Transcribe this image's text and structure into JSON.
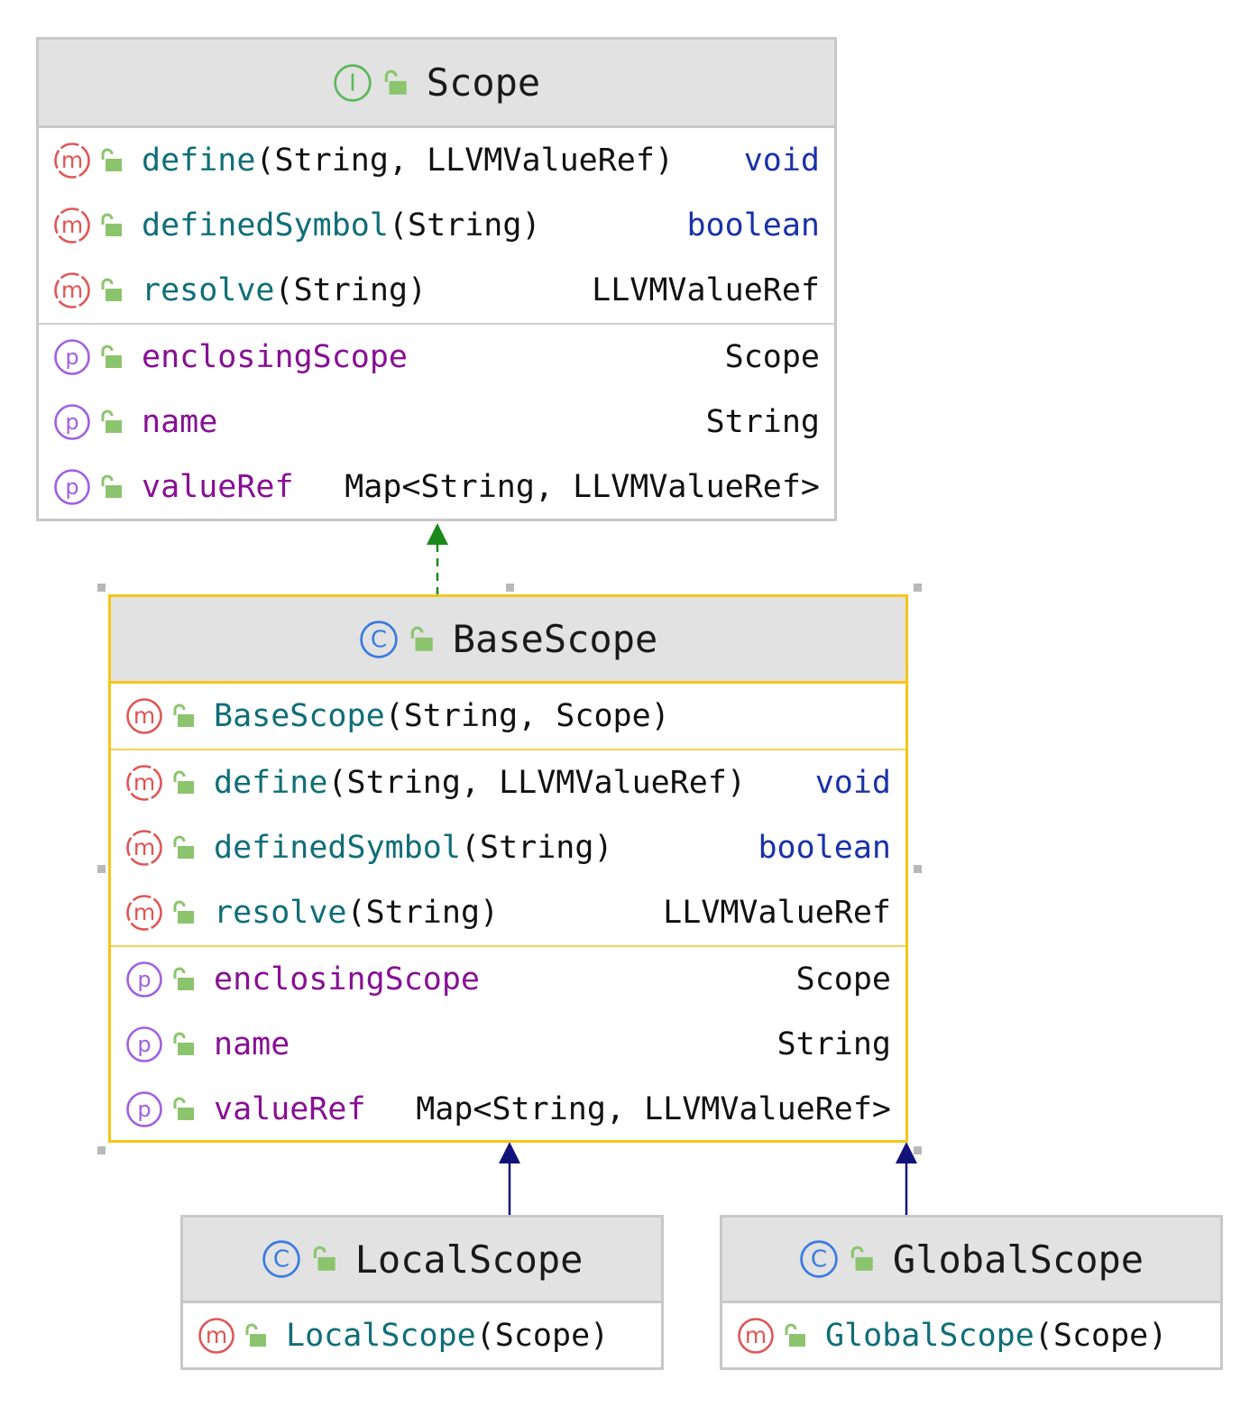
{
  "classes": {
    "scope": {
      "kind": "interface",
      "badge": "I",
      "name": "Scope",
      "methods": [
        {
          "name": "define",
          "params": "(String, LLVMValueRef)",
          "type": "void",
          "keyword": true
        },
        {
          "name": "definedSymbol",
          "params": "(String)",
          "type": "boolean",
          "keyword": true
        },
        {
          "name": "resolve",
          "params": "(String)",
          "type": "LLVMValueRef",
          "keyword": false
        }
      ],
      "properties": [
        {
          "name": "enclosingScope",
          "type": "Scope"
        },
        {
          "name": "name",
          "type": "String"
        },
        {
          "name": "valueRef",
          "type": "Map<String, LLVMValueRef>"
        }
      ]
    },
    "baseScope": {
      "kind": "class",
      "badge": "C",
      "name": "BaseScope",
      "selected": true,
      "constructors": [
        {
          "name": "BaseScope",
          "params": "(String, Scope)"
        }
      ],
      "methods": [
        {
          "name": "define",
          "params": "(String, LLVMValueRef)",
          "type": "void",
          "keyword": true
        },
        {
          "name": "definedSymbol",
          "params": "(String)",
          "type": "boolean",
          "keyword": true
        },
        {
          "name": "resolve",
          "params": "(String)",
          "type": "LLVMValueRef",
          "keyword": false
        }
      ],
      "properties": [
        {
          "name": "enclosingScope",
          "type": "Scope"
        },
        {
          "name": "name",
          "type": "String"
        },
        {
          "name": "valueRef",
          "type": "Map<String, LLVMValueRef>"
        }
      ]
    },
    "localScope": {
      "kind": "class",
      "badge": "C",
      "name": "LocalScope",
      "constructors": [
        {
          "name": "LocalScope",
          "params": "(Scope)"
        }
      ]
    },
    "globalScope": {
      "kind": "class",
      "badge": "C",
      "name": "GlobalScope",
      "constructors": [
        {
          "name": "GlobalScope",
          "params": "(Scope)"
        }
      ]
    }
  },
  "relations": [
    {
      "from": "BaseScope",
      "to": "Scope",
      "kind": "implements"
    },
    {
      "from": "LocalScope",
      "to": "BaseScope",
      "kind": "extends"
    },
    {
      "from": "GlobalScope",
      "to": "BaseScope",
      "kind": "extends"
    }
  ],
  "colors": {
    "method_name": "#0f6e78",
    "property_name": "#871094",
    "keyword": "#1a31a8",
    "implements_arrow": "#1a8a1a",
    "extends_arrow": "#12127a",
    "selection_border": "#f5c518",
    "lock": "#8cc46e",
    "interface_badge": "#5cb85c",
    "class_badge": "#3a7be0",
    "method_badge": "#e05555",
    "property_badge": "#a060e0"
  },
  "icons": {
    "interface": "interface-icon",
    "class": "class-icon",
    "method": "method-icon",
    "property": "property-icon",
    "visibility": "public-lock-icon"
  }
}
